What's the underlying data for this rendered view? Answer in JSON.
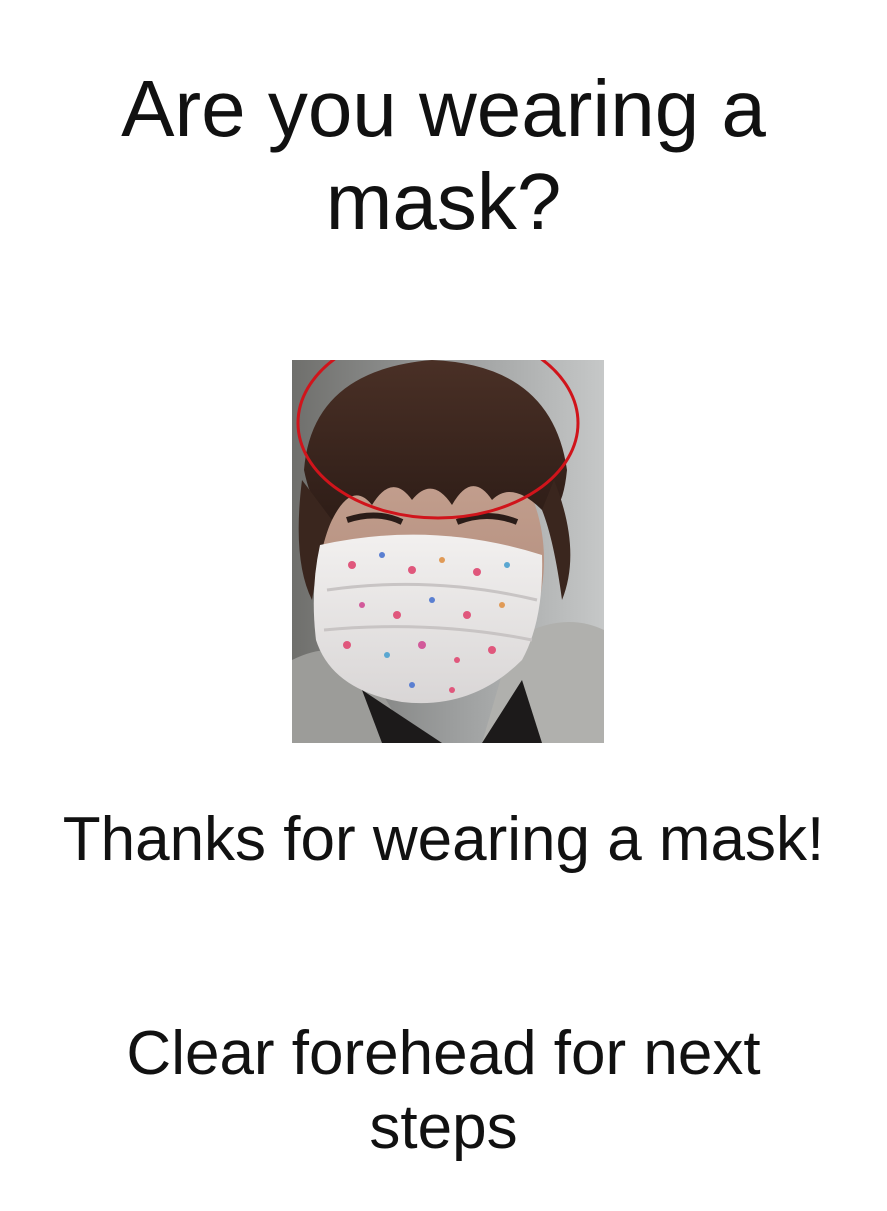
{
  "screen": {
    "title": "Are you wearing a mask?",
    "camera_preview": {
      "description_icon": "face-with-mask-photo",
      "guide_color": "#d0141b"
    },
    "status_message": "Thanks for wearing a mask!",
    "instruction_message": "Clear forehead for next steps"
  }
}
